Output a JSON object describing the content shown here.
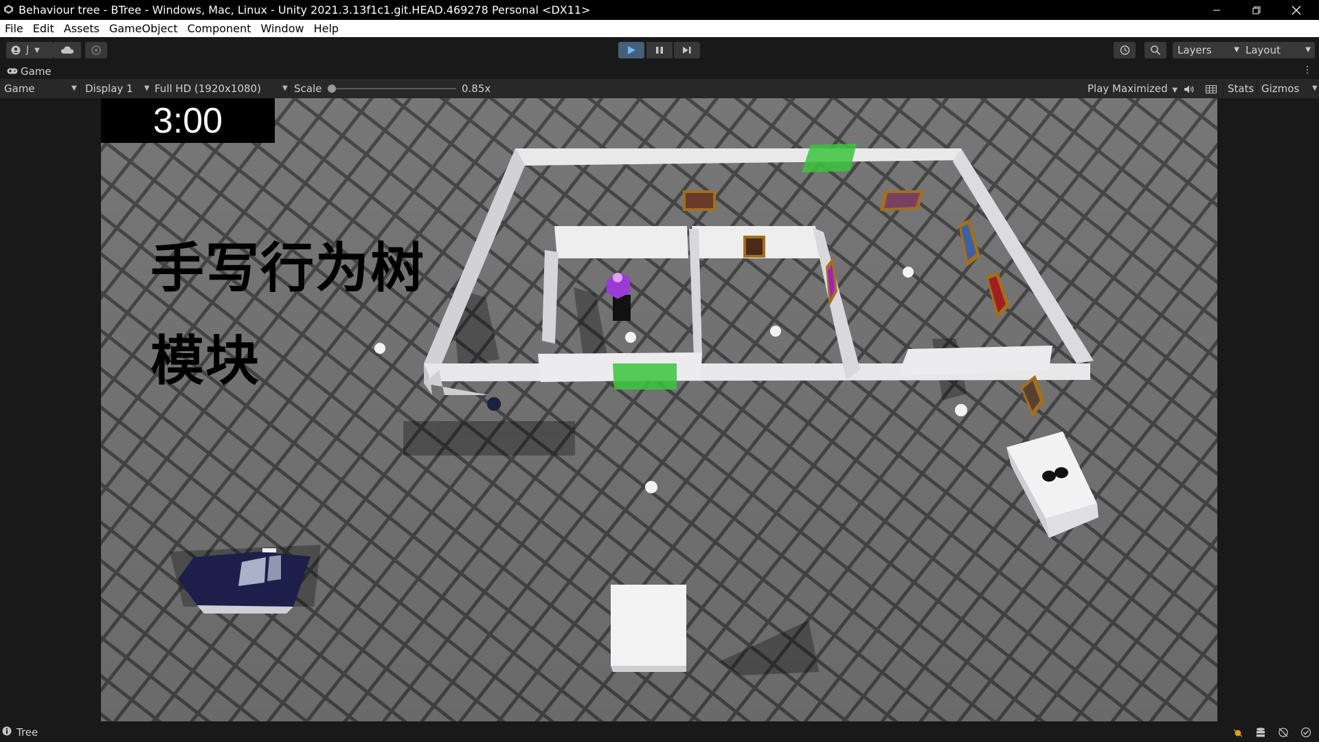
{
  "window": {
    "title": "Behaviour tree - BTree - Windows, Mac, Linux - Unity 2021.3.13f1c1.git.HEAD.469278 Personal <DX11>"
  },
  "menu": [
    "File",
    "Edit",
    "Assets",
    "GameObject",
    "Component",
    "Window",
    "Help"
  ],
  "toolbar": {
    "account_label": "J",
    "layers_label": "Layers",
    "layout_label": "Layout"
  },
  "game_tab": {
    "label": "Game"
  },
  "game_bar": {
    "view_mode": "Game",
    "display": "Display 1",
    "resolution": "Full HD (1920x1080)",
    "scale_label": "Scale",
    "scale_value": "0.85x",
    "play_mode": "Play Maximized",
    "stats_label": "Stats",
    "gizmos_label": "Gizmos"
  },
  "scene": {
    "timer": "3:00",
    "title_line1": "手写行为树",
    "title_line2": "模块"
  },
  "status": {
    "text": "Tree"
  },
  "colors": {
    "accent_blue": "#5b9bd5",
    "green_zone": "#3cc43c",
    "floor": "#7a7a7a"
  }
}
